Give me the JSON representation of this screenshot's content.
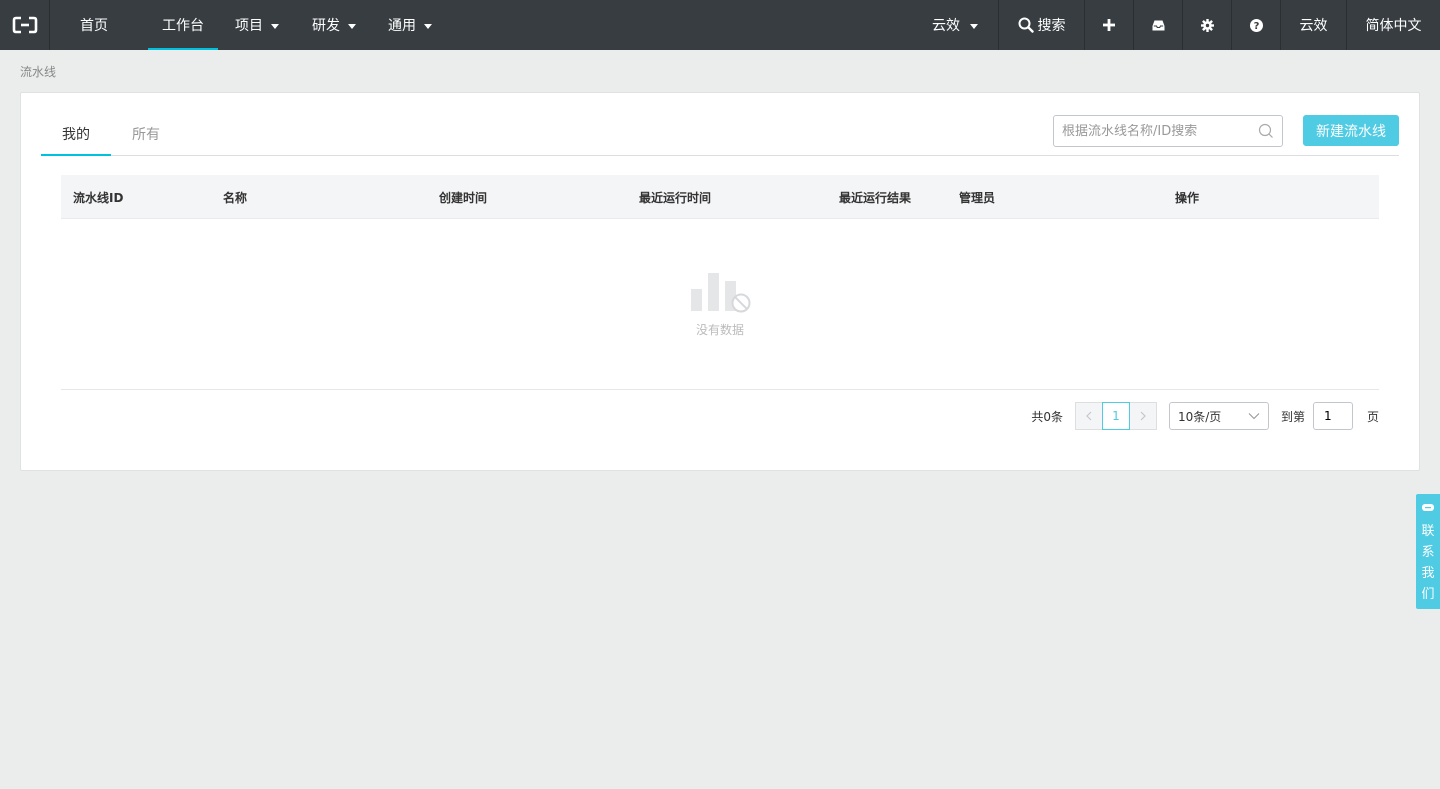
{
  "nav": {
    "items": [
      {
        "label": "首页"
      },
      {
        "label": "工作台"
      },
      {
        "label": "项目"
      },
      {
        "label": "研发"
      },
      {
        "label": "通用"
      }
    ],
    "org": "云效",
    "search": "搜索",
    "yun": "云效",
    "lang": "简体中文"
  },
  "breadcrumb": "流水线",
  "tabs": [
    {
      "label": "我的"
    },
    {
      "label": "所有"
    }
  ],
  "search": {
    "placeholder": "根据流水线名称/ID搜索"
  },
  "new_button": "新建流水线",
  "table": {
    "columns": [
      "流水线ID",
      "名称",
      "创建时间",
      "最近运行时间",
      "最近运行结果",
      "管理员",
      "操作"
    ],
    "empty_text": "没有数据"
  },
  "pagination": {
    "total": "共0条",
    "current_page": "1",
    "page_size": "10条/页",
    "goto_label": "到第",
    "goto_value": "1",
    "page_unit": "页"
  },
  "contact": "联系我们",
  "colors": {
    "accent": "#00c1de",
    "button": "#4fcbe3",
    "topbar": "#373d41"
  }
}
